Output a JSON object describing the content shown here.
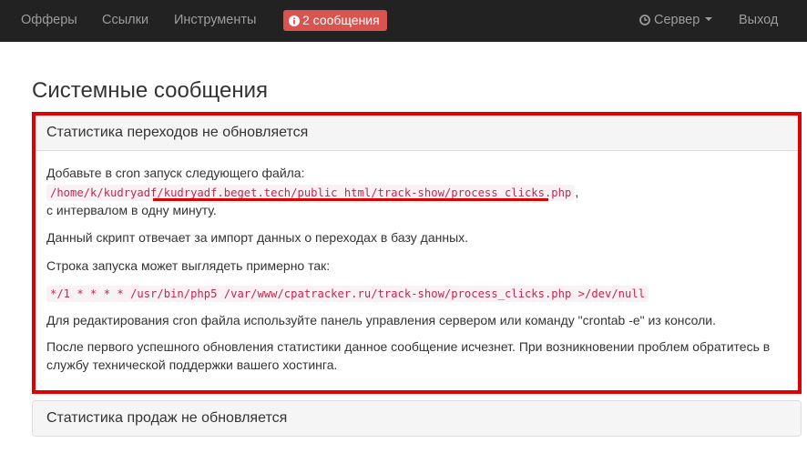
{
  "navbar": {
    "items": [
      {
        "label": "Офферы"
      },
      {
        "label": "Ссылки"
      },
      {
        "label": "Инструменты"
      }
    ],
    "messages_badge": "2 сообщения",
    "server_menu": "Сервер",
    "logout": "Выход"
  },
  "page": {
    "title": "Системные сообщения"
  },
  "panels": [
    {
      "heading": "Статистика переходов не обновляется",
      "line1": "Добавьте в cron запуск следующего файла:",
      "file_path": "/home/k/kudryadf/kudryadf.beget.tech/public_html/track-show/process_clicks.php",
      "comma": ",",
      "line2": "с интервалом в одну минуту.",
      "line3": "Данный скрипт отвечает за импорт данных о переходах в базу данных.",
      "line4": "Строка запуска может выглядеть примерно так:",
      "cron_example": "*/1 * * * * /usr/bin/php5 /var/www/cpatracker.ru/track-show/process_clicks.php >/dev/null",
      "line5": "Для редактирования cron файла используйте панель управления сервером или команду \"crontab -e\" из консоли.",
      "line6a": "После первого успешного обновления статистики данное сообщение исчезнет. При возникновении проблем обратитесь в",
      "line6b": "службу технической поддержки вашего хостинга."
    },
    {
      "heading": "Статистика продаж не обновляется"
    }
  ],
  "colors": {
    "navbar_bg": "#222222",
    "badge_bg": "#d9534f",
    "highlight_red": "#e00000",
    "code_text": "#c7254e"
  }
}
